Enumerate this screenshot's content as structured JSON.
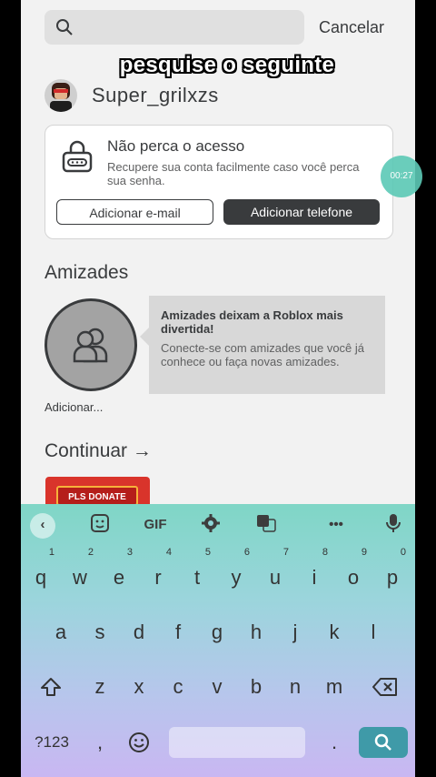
{
  "search": {
    "placeholder": "",
    "cancel_label": "Cancelar"
  },
  "overlay_caption": "pesquise o seguinte",
  "user": {
    "username": "Super_grilxzs"
  },
  "account_card": {
    "title": "Não perca o acesso",
    "description": "Recupere sua conta facilmente caso você perca sua senha.",
    "email_button": "Adicionar e-mail",
    "phone_button": "Adicionar telefone"
  },
  "recording_timer": "00:27",
  "friends": {
    "section_title": "Amizades",
    "add_label": "Adicionar...",
    "tip_title": "Amizades deixam a Roblox mais divertida!",
    "tip_body": "Conecte-se com amizades que você já conhece ou faça novas amizades."
  },
  "continue": {
    "section_title": "Continuar →",
    "game_thumb_text": "PLS DONATE"
  },
  "keyboard": {
    "toolbar": {
      "gif_label": "GIF",
      "more_label": "•••"
    },
    "row1": [
      {
        "key": "q",
        "alt": "1"
      },
      {
        "key": "w",
        "alt": "2"
      },
      {
        "key": "e",
        "alt": "3"
      },
      {
        "key": "r",
        "alt": "4"
      },
      {
        "key": "t",
        "alt": "5"
      },
      {
        "key": "y",
        "alt": "6"
      },
      {
        "key": "u",
        "alt": "7"
      },
      {
        "key": "i",
        "alt": "8"
      },
      {
        "key": "o",
        "alt": "9"
      },
      {
        "key": "p",
        "alt": "0"
      }
    ],
    "row2": [
      "a",
      "s",
      "d",
      "f",
      "g",
      "h",
      "j",
      "k",
      "l"
    ],
    "row3": [
      "z",
      "x",
      "c",
      "v",
      "b",
      "n",
      "m"
    ],
    "symbols_label": "?123",
    "comma": ",",
    "period": "."
  },
  "colors": {
    "keyboard_action": "#3f9aa8",
    "dark_button": "#393b3d",
    "timer": "#5cc9b6"
  }
}
